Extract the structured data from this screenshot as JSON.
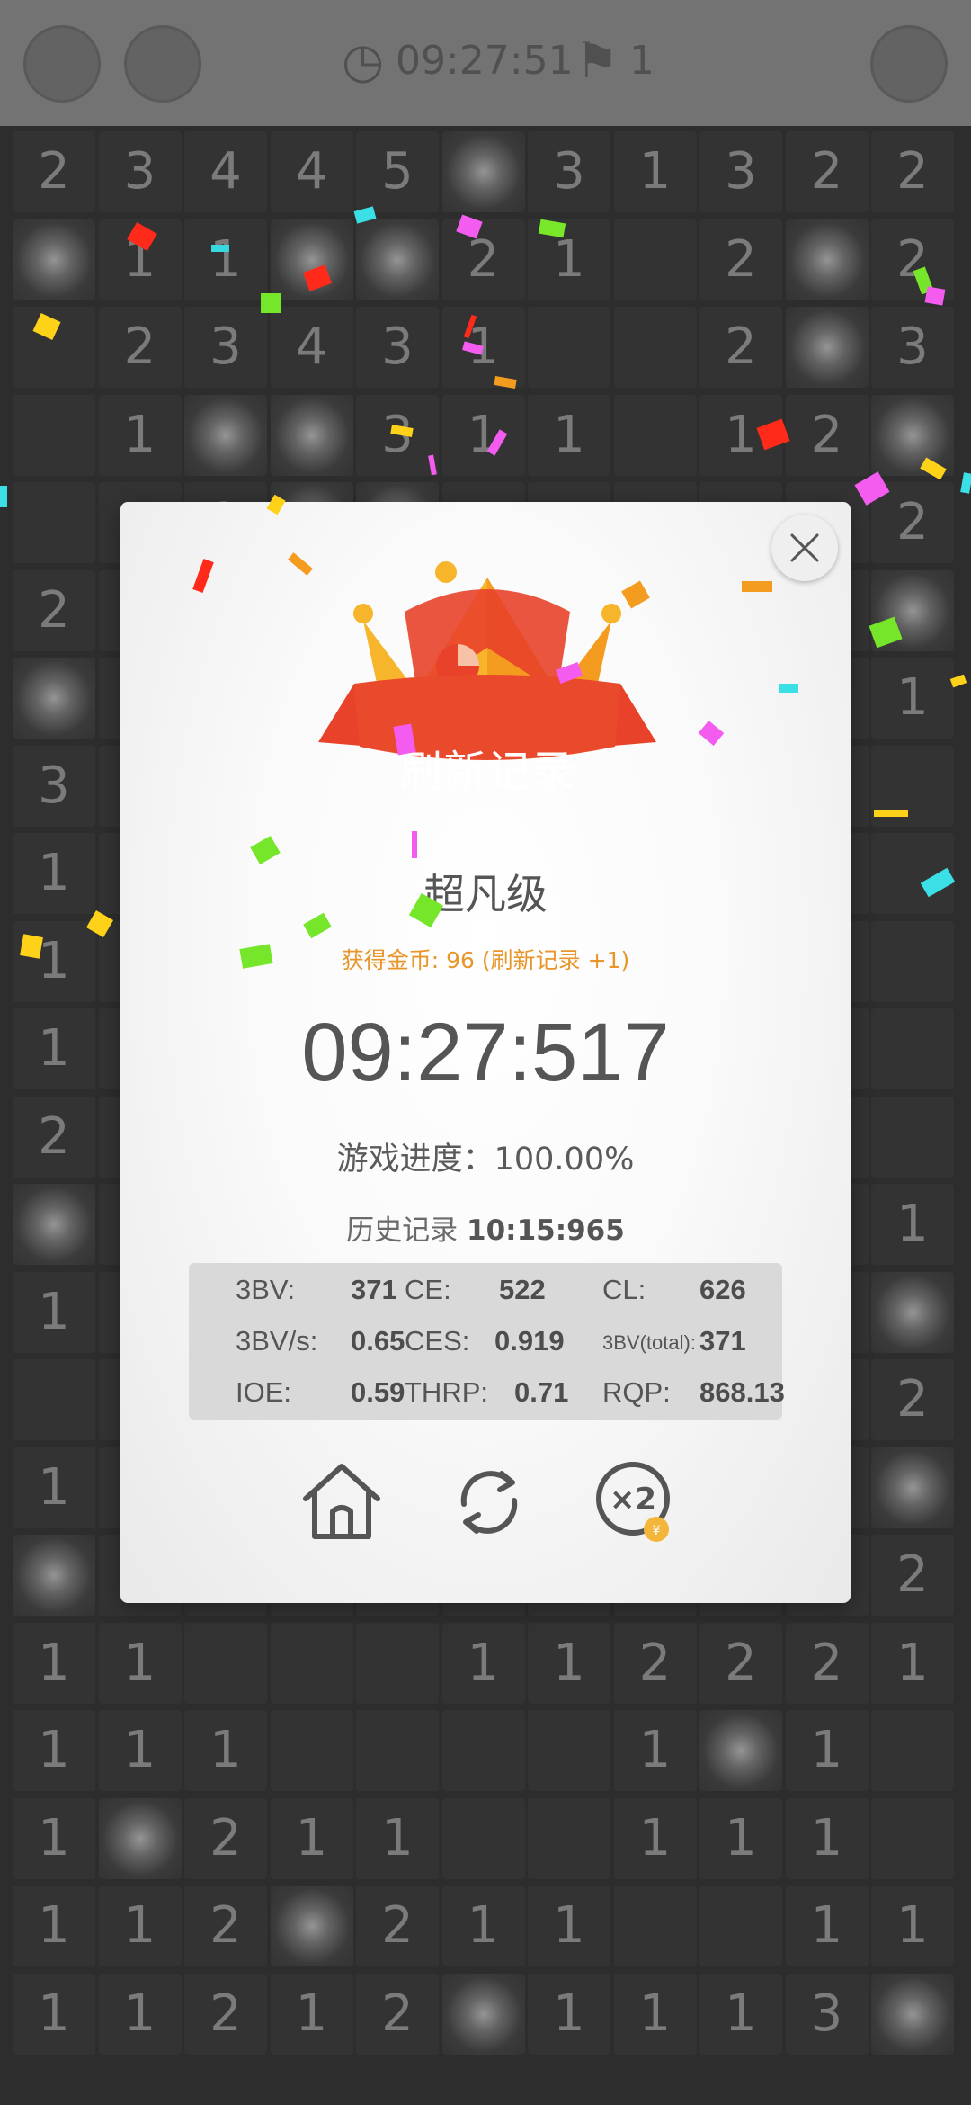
{
  "topbar": {
    "timer_text": "09:27:51",
    "flags_text": "1"
  },
  "board": {
    "rows": [
      [
        "2",
        "3",
        "4",
        "4",
        "5",
        "*",
        "3",
        "1",
        "3",
        "2",
        "2"
      ],
      [
        "*",
        "1",
        "1",
        "*",
        "*",
        "2",
        "1",
        "",
        "2",
        "*",
        "2"
      ],
      [
        "",
        "2",
        "3",
        "4",
        "3",
        "1",
        "",
        "",
        "2",
        "*",
        "3"
      ],
      [
        "",
        "1",
        "*",
        "*",
        "3",
        "1",
        "1",
        "",
        "1",
        "2",
        "*"
      ],
      [
        "",
        "1",
        "2",
        "*",
        "*",
        "1",
        "",
        "",
        "",
        "",
        "2"
      ],
      [
        "2",
        "",
        "",
        "",
        "",
        "",
        "",
        "",
        "",
        "",
        "*"
      ],
      [
        "*",
        "",
        "",
        "",
        "",
        "",
        "",
        "",
        "",
        "",
        "1"
      ],
      [
        "3",
        "",
        "",
        "",
        "",
        "",
        "",
        "",
        "",
        "",
        ""
      ],
      [
        "1",
        "",
        "",
        "",
        "",
        "",
        "",
        "",
        "",
        "",
        ""
      ],
      [
        "1",
        "",
        "",
        "",
        "",
        "",
        "",
        "",
        "",
        "",
        ""
      ],
      [
        "1",
        "",
        "",
        "",
        "",
        "",
        "",
        "",
        "",
        "",
        ""
      ],
      [
        "2",
        "",
        "",
        "",
        "",
        "",
        "",
        "",
        "",
        "",
        ""
      ],
      [
        "*",
        "",
        "",
        "",
        "",
        "",
        "",
        "",
        "",
        "",
        "1"
      ],
      [
        "1",
        "",
        "",
        "",
        "",
        "",
        "",
        "",
        "",
        "",
        "*"
      ],
      [
        "",
        "",
        "",
        "",
        "",
        "",
        "",
        "",
        "",
        "",
        "2"
      ],
      [
        "1",
        "",
        "",
        "",
        "",
        "",
        "",
        "",
        "",
        "",
        "*"
      ],
      [
        "*",
        "",
        "",
        "",
        "",
        "",
        "",
        "",
        "",
        "",
        "2"
      ],
      [
        "1",
        "1",
        "",
        "",
        "",
        "1",
        "1",
        "2",
        "2",
        "2",
        "1"
      ],
      [
        "1",
        "1",
        "1",
        "",
        "",
        "",
        "",
        "1",
        "*",
        "1",
        ""
      ],
      [
        "1",
        "*",
        "2",
        "1",
        "1",
        "",
        "",
        "1",
        "1",
        "1",
        ""
      ],
      [
        "1",
        "1",
        "2",
        "*",
        "2",
        "1",
        "1",
        "",
        "",
        "1",
        "1"
      ],
      [
        "1",
        "1",
        "2",
        "1",
        "2",
        "*",
        "1",
        "1",
        "1",
        "3",
        "*"
      ]
    ]
  },
  "dialog": {
    "banner_text": "刷新记录",
    "level_text": "超凡级",
    "coins_text": "获得金币: 96 (刷新记录 +1)",
    "time_text": "09:27:517",
    "progress_text": "游戏进度：100.00%",
    "history_label": "历史记录",
    "history_value": "10:15:965",
    "stats": [
      {
        "label": "3BV:",
        "value": "371"
      },
      {
        "label": "CE:",
        "value": "522"
      },
      {
        "label": "CL:",
        "value": "626"
      },
      {
        "label": "3BV/s:",
        "value": "0.65"
      },
      {
        "label": "CES:",
        "value": "0.919"
      },
      {
        "label": "3BV(total):",
        "value": "371"
      },
      {
        "label": "IOE:",
        "value": "0.59"
      },
      {
        "label": "THRP:",
        "value": "0.71"
      },
      {
        "label": "RQP:",
        "value": "868.13"
      }
    ],
    "double_label": "×2"
  },
  "icons": [
    "settings-icon",
    "palette-icon",
    "clock-icon",
    "flag-icon",
    "eye-off-icon",
    "crown-icon",
    "close-icon",
    "home-icon",
    "refresh-icon",
    "double-coins-icon"
  ],
  "colors": {
    "accent_orange": "#e8962a",
    "banner_red": "#e8432a",
    "crown_gold": "#f7b52b"
  }
}
